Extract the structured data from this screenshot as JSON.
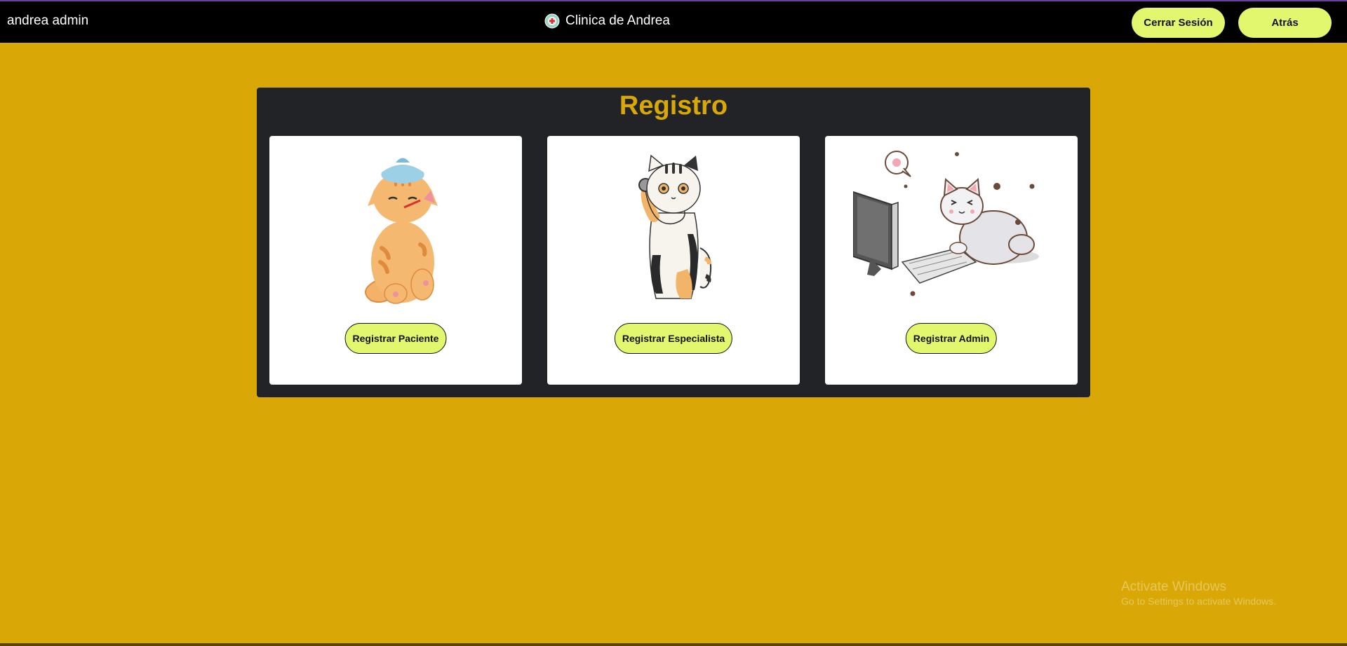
{
  "navbar": {
    "user_name": "andrea admin",
    "brand_name": "Clinica de Andrea",
    "logout_label": "Cerrar Sesión",
    "back_label": "Atrás"
  },
  "page": {
    "title": "Registro",
    "cards": [
      {
        "button_label": "Registrar Paciente",
        "illustration": "sick-cat-illustration"
      },
      {
        "button_label": "Registrar Especialista",
        "illustration": "doctor-cat-illustration"
      },
      {
        "button_label": "Registrar Admin",
        "illustration": "computer-cat-illustration"
      }
    ]
  },
  "os_watermark": {
    "title": "Activate Windows",
    "subtitle": "Go to Settings to activate Windows."
  },
  "colors": {
    "background": "#d9a806",
    "navbar": "#000000",
    "panel": "#212327",
    "accent_button": "#e2f76d",
    "title": "#d9a806"
  }
}
